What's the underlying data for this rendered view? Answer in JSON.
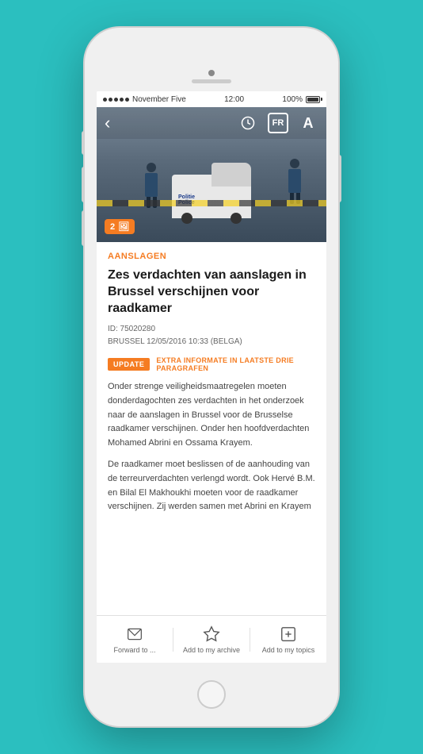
{
  "background_color": "#2bbfbf",
  "status_bar": {
    "carrier": "November Five",
    "time": "12:00",
    "battery": "100%"
  },
  "nav": {
    "back_label": "‹",
    "icons": [
      "history",
      "FR",
      "A"
    ]
  },
  "image": {
    "counter": "2",
    "counter_icon": "🖼"
  },
  "article": {
    "category": "AANSLAGEN",
    "title": "Zes verdachten van aanslagen in Brussel verschijnen voor raadkamer",
    "id_line": "ID: 75020280",
    "source_line": "BRUSSEL 12/05/2016 10:33 (BELGA)",
    "update_badge": "UPDATE",
    "update_text": "EXTRA INFORMATE IN LAATSTE DRIE PARAGRAFEN",
    "body_1": "Onder strenge veiligheidsmaatregelen moeten donderdagochten zes verdachten in het onderzoek naar de aanslagen in Brussel voor de Brusselse raadkamer verschijnen. Onder hen hoofdverdachten Mohamed Abrini en Ossama Krayem.",
    "body_2": "De raadkamer moet beslissen of de aanhouding van de terreurverdachten verlengd wordt. Ook Hervé B.M. en Bilal El Makhoukhi moeten voor de raadkamer verschijnen. Zij werden samen met Abrini en Krayem"
  },
  "toolbar": {
    "items": [
      {
        "id": "forward",
        "icon": "✉",
        "label": "Forward to ..."
      },
      {
        "id": "archive",
        "icon": "☆",
        "label": "Add to my archive"
      },
      {
        "id": "topics",
        "icon": "⊞",
        "label": "Add to my topics"
      }
    ]
  }
}
